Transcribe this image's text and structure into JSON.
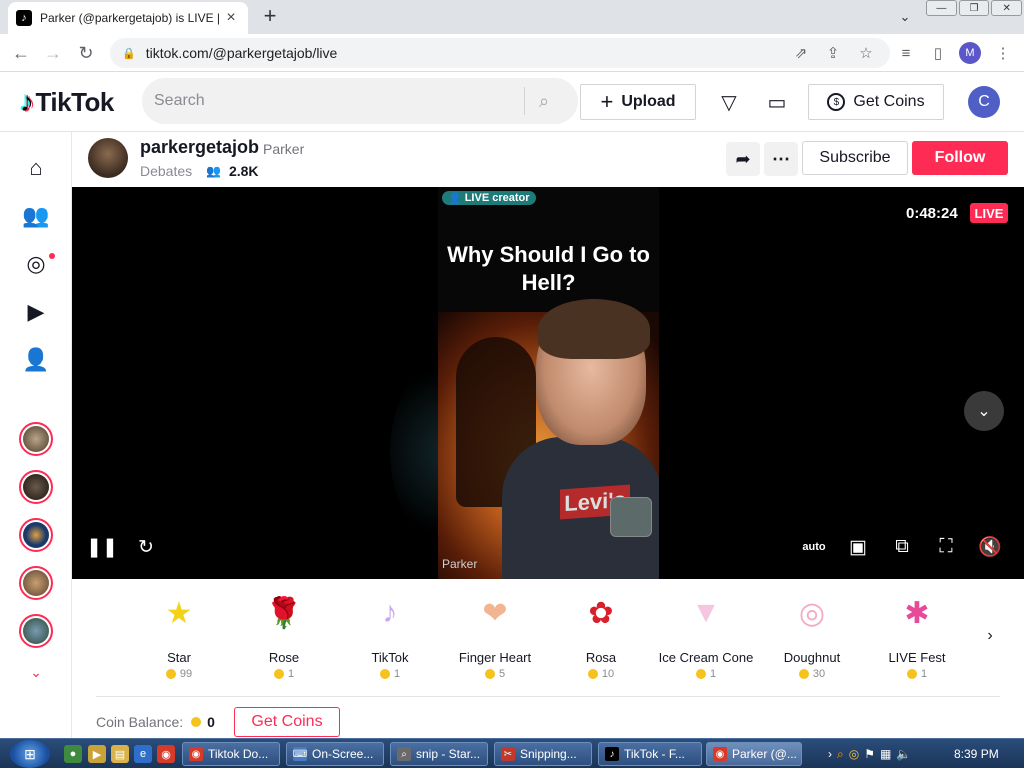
{
  "browser": {
    "tab_title": "Parker (@parkergetajob) is LIVE |",
    "url": "tiktok.com/@parkergetajob/live",
    "profile_initial": "M"
  },
  "header": {
    "logo_text": "TikTok",
    "search_placeholder": "Search",
    "upload_label": "Upload",
    "get_coins_label": "Get Coins",
    "avatar_initial": "C"
  },
  "creator": {
    "username": "parkergetajob",
    "display_name": "Parker",
    "category": "Debates",
    "viewers": "2.8K",
    "subscribe_label": "Subscribe",
    "follow_label": "Follow"
  },
  "video": {
    "live_creator_badge": "LIVE creator",
    "title": "Why Should I Go to Hell?",
    "shirt_text": "Levi's",
    "watermark": "Parker",
    "timer": "0:48:24",
    "live_badge": "LIVE",
    "quality_label": "auto"
  },
  "gifts": [
    {
      "name": "Star",
      "price": "99",
      "icon": "star-gift",
      "color": "#f5d21a",
      "glyph": "★"
    },
    {
      "name": "Rose",
      "price": "1",
      "icon": "rose-gift",
      "color": "#e0243c",
      "glyph": "🌹"
    },
    {
      "name": "TikTok",
      "price": "1",
      "icon": "tiktok-gift",
      "color": "#c9a6f0",
      "glyph": "♪"
    },
    {
      "name": "Finger Heart",
      "price": "5",
      "icon": "finger-heart-gift",
      "color": "#f3b490",
      "glyph": "❤"
    },
    {
      "name": "Rosa",
      "price": "10",
      "icon": "rosa-gift",
      "color": "#d81f2a",
      "glyph": "✿"
    },
    {
      "name": "Ice Cream Cone",
      "price": "1",
      "icon": "ice-cream-gift",
      "color": "#f4c6df",
      "glyph": "▼"
    },
    {
      "name": "Doughnut",
      "price": "30",
      "icon": "doughnut-gift",
      "color": "#f6a8c2",
      "glyph": "◎"
    },
    {
      "name": "LIVE Fest",
      "price": "1",
      "icon": "live-fest-gift",
      "color": "#e84a9a",
      "glyph": "✱"
    }
  ],
  "coin_bar": {
    "balance_label": "Coin Balance:",
    "balance_value": "0",
    "get_coins_label": "Get Coins"
  },
  "taskbar": {
    "buttons": [
      "Tiktok Do...",
      "On-Scree...",
      "snip - Star...",
      "Snipping...",
      "TikTok - F...",
      "Parker (@..."
    ],
    "clock": "8:39 PM"
  },
  "colors": {
    "brand_red": "#fe2c55",
    "live_creator_teal": "#1f7a7a",
    "taskbar_blue": "#1b3458"
  }
}
